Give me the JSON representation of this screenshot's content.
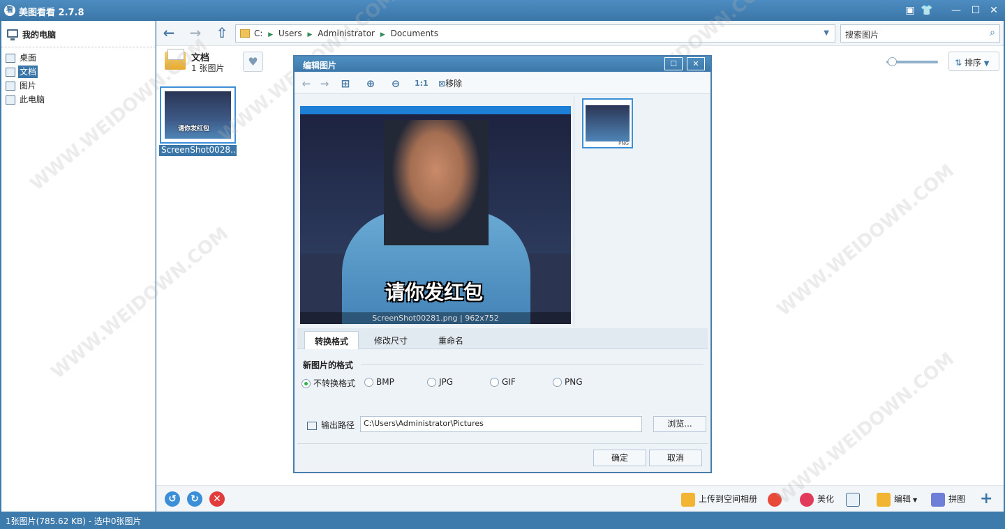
{
  "app": {
    "title": "美图看看 2.7.8"
  },
  "sidebar": {
    "header": "我的电脑",
    "items": [
      {
        "label": "桌面",
        "icon": "desktop-icon"
      },
      {
        "label": "文档",
        "icon": "document-icon",
        "selected": true
      },
      {
        "label": "图片",
        "icon": "pictures-icon"
      },
      {
        "label": "此电脑",
        "icon": "computer-icon"
      }
    ]
  },
  "address": {
    "drive": "C:",
    "crumbs": [
      "Users",
      "Administrator",
      "Documents"
    ]
  },
  "search": {
    "placeholder": "搜索图片"
  },
  "folder": {
    "name": "文档",
    "count": "1 张图片"
  },
  "sort": {
    "label": "排序"
  },
  "thumbnail": {
    "name": "ScreenShot0028...",
    "caption": "请你发红包"
  },
  "dialog": {
    "title": "编辑图片",
    "toolbar": {
      "remove_label": "移除",
      "ratio_label": "1:1"
    },
    "preview": {
      "subtitle": "请你发红包",
      "caption": "ScreenShot00281.png | 962x752",
      "tag": "PNG"
    },
    "tabs": [
      "转换格式",
      "修改尺寸",
      "重命名"
    ],
    "format_title": "新图片的格式",
    "formats": [
      {
        "label": "不转换格式",
        "checked": true
      },
      {
        "label": "BMP",
        "checked": false
      },
      {
        "label": "JPG",
        "checked": false
      },
      {
        "label": "GIF",
        "checked": false
      },
      {
        "label": "PNG",
        "checked": false
      }
    ],
    "output_label": "输出路径",
    "output_path": "C:\\Users\\Administrator\\Pictures",
    "browse_label": "浏览...",
    "ok_label": "确定",
    "cancel_label": "取消"
  },
  "bottom": {
    "upload_label": "上传到空间相册",
    "beautify_label": "美化",
    "edit_label": "编辑",
    "collage_label": "拼图"
  },
  "status": "1张图片(785.62 KB) - 选中0张图片",
  "watermark": "WWW.WEIDOWN.COM"
}
